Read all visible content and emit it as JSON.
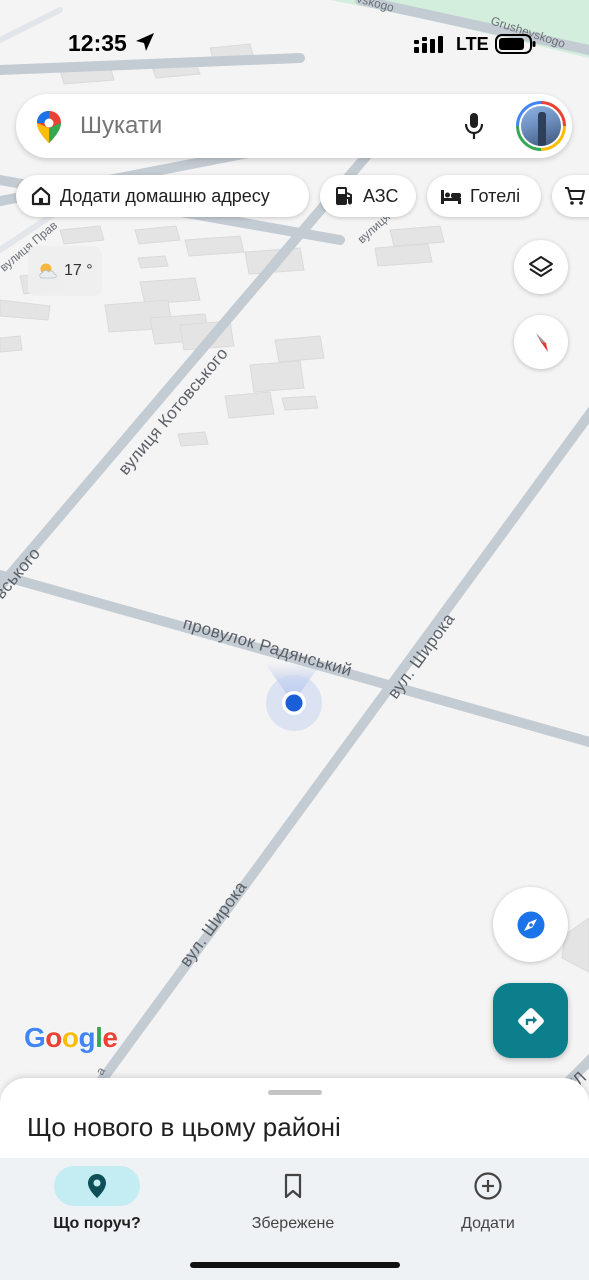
{
  "status_bar": {
    "time": "12:35",
    "network": "LTE"
  },
  "map": {
    "roads": {
      "road_1": "вулиця Котовського",
      "road_2": "провулок Радянський",
      "road_3": "вул. Широка",
      "road_4": "вул. Широка",
      "road_5": "вулиця Прав",
      "road_6": "вулиця П",
      "road_7": "Grushevskogo",
      "road_8": "vskogo",
      "road_9": "вського",
      "road_10": "УЛ",
      "road_11": "а"
    },
    "weather": {
      "temperature": "17 °",
      "icon": "partly-cloudy-icon"
    }
  },
  "search": {
    "placeholder": "Шукати"
  },
  "chips": {
    "home": "Додати домашню адресу",
    "gas": "АЗС",
    "hotels": "Готелі"
  },
  "logo": {
    "g1": "G",
    "o1": "o",
    "o2": "o",
    "g2": "g",
    "l": "l",
    "e": "e"
  },
  "bottom_sheet": {
    "title": "Що нового в цьому районі"
  },
  "nav": {
    "explore": "Що поруч?",
    "saved": "Збережене",
    "contribute": "Додати"
  },
  "colors": {
    "accent_teal": "#0b7f8c",
    "location_blue": "#1a5fd8",
    "active_tab": "#c3ecf3"
  }
}
